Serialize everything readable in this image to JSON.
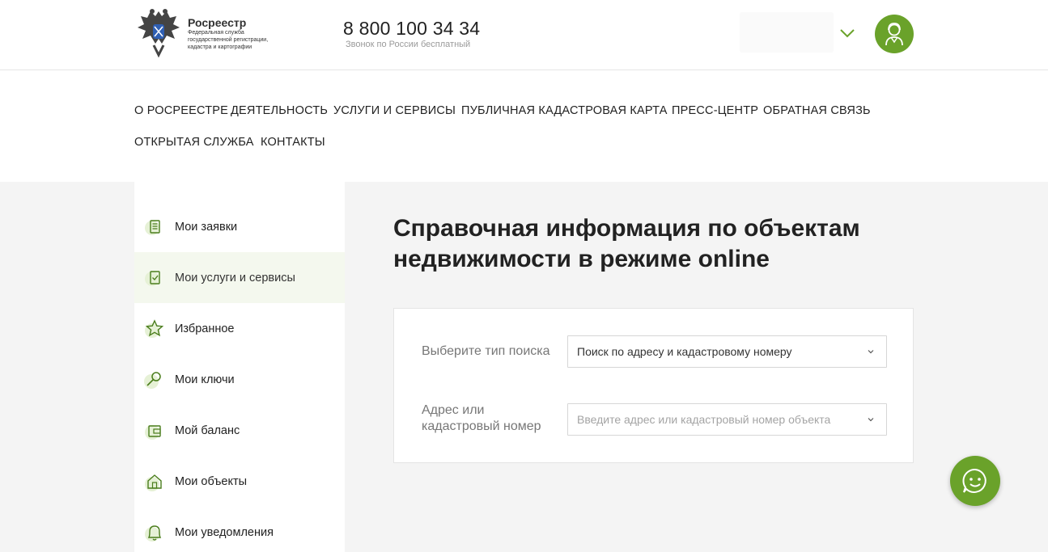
{
  "header": {
    "logo_name": "Росреестр",
    "logo_subtitle": "Федеральная служба государственной регистрации, кадастра и картографии",
    "phone": "8 800 100 34 34",
    "phone_note": "Звонок по России бесплатный"
  },
  "nav": {
    "items": [
      "О РОСРЕЕСТРЕ",
      "ДЕЯТЕЛЬНОСТЬ",
      "УСЛУГИ И СЕРВИСЫ",
      "ПУБЛИЧНАЯ КАДАСТРОВАЯ КАРТА",
      "ПРЕСС-ЦЕНТР",
      "ОБРАТНАЯ СВЯЗЬ",
      "ОТКРЫТАЯ СЛУЖБА",
      "КОНТАКТЫ"
    ]
  },
  "sidebar": {
    "items": [
      {
        "label": "Мои заявки",
        "icon": "document-icon"
      },
      {
        "label": "Мои услуги и сервисы",
        "icon": "checklist-icon",
        "active": true
      },
      {
        "label": "Избранное",
        "icon": "star-icon"
      },
      {
        "label": "Мои ключи",
        "icon": "key-icon"
      },
      {
        "label": "Мой баланс",
        "icon": "wallet-icon"
      },
      {
        "label": "Мои объекты",
        "icon": "house-icon"
      },
      {
        "label": "Мои уведомления",
        "icon": "bell-icon"
      }
    ]
  },
  "main": {
    "title": "Справочная информация по объектам недвижимости в режиме online",
    "search_type_label": "Выберите тип поиска",
    "search_type_value": "Поиск по адресу и кадастровому номеру",
    "address_label_line1": "Адрес или",
    "address_label_line2": "кадастровый номер",
    "address_placeholder": "Введите адрес или кадастровый номер объекта"
  },
  "colors": {
    "accent": "#6aa22a",
    "active_bg": "#f4f8ee",
    "page_bg": "#f4f4f4"
  }
}
